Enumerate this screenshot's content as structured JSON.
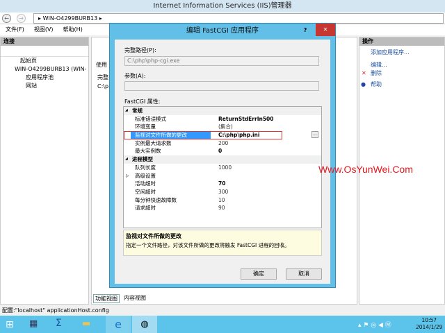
{
  "window": {
    "title": "Internet Information Services (IIS)管理器"
  },
  "address": {
    "path": "WIN-O4299BURB13",
    "sep": "▸"
  },
  "menu": [
    "文件(F)",
    "视图(V)",
    "帮助(H)"
  ],
  "left": {
    "header": "连接",
    "tree": [
      "起始页",
      "WIN-O4299BURB13 (WIN-",
      "应用程序池",
      "网站"
    ]
  },
  "center": {
    "label": "使用",
    "col": "完整",
    "cell": "C:\\p",
    "tabs": [
      "功能视图",
      "内容视图"
    ]
  },
  "right": {
    "header": "操作",
    "actions": [
      "添加应用程序...",
      "编辑...",
      "删除",
      "帮助"
    ]
  },
  "dialog": {
    "title": "编辑 FastCGI 应用程序",
    "help": "?",
    "close": "✕",
    "fullpath_label": "完整路径(P):",
    "fullpath_value": "C:\\php\\php-cgi.exe",
    "args_label": "参数(A):",
    "args_value": "",
    "props_label": "FastCGI 属性:",
    "rows": [
      {
        "cat": true,
        "name": "常规"
      },
      {
        "name": "标准错误模式",
        "value": "ReturnStdErrIn500",
        "bold": true
      },
      {
        "name": "环境变量",
        "value": "(集合)"
      },
      {
        "name": "监视对文件所做的更改",
        "value": "C:\\php\\php.ini",
        "bold": true,
        "selected": true
      },
      {
        "name": "实例最大请求数",
        "value": "200"
      },
      {
        "name": "最大实例数",
        "value": "0",
        "bold": true
      },
      {
        "cat": true,
        "name": "进程模型"
      },
      {
        "name": "队列长度",
        "value": "1000"
      },
      {
        "name": "高级设置",
        "value": "",
        "expand": true
      },
      {
        "name": "活动超时",
        "value": "70",
        "bold": true
      },
      {
        "name": "空闲超时",
        "value": "300"
      },
      {
        "name": "每分钟快速故障数",
        "value": "10"
      },
      {
        "name": "请求超时",
        "value": "90"
      }
    ],
    "desc_title": "监视对文件所做的更改",
    "desc_text": "指定一个文件路径，对该文件所做的更改将触发 FastCGI 进程的回收。",
    "ok": "确定",
    "cancel": "取消",
    "ellipsis": "..."
  },
  "watermark": "Www.OsYunWei.Com",
  "status": "配置:\"localhost\" applicationHost.config",
  "clock": {
    "time": "10:57",
    "date": "2014/1/29"
  },
  "colors": {
    "accent": "#62c0e8",
    "taskbar": "#5cc3ea",
    "watermark": "#e8141b",
    "highlight": "#3399ff"
  }
}
